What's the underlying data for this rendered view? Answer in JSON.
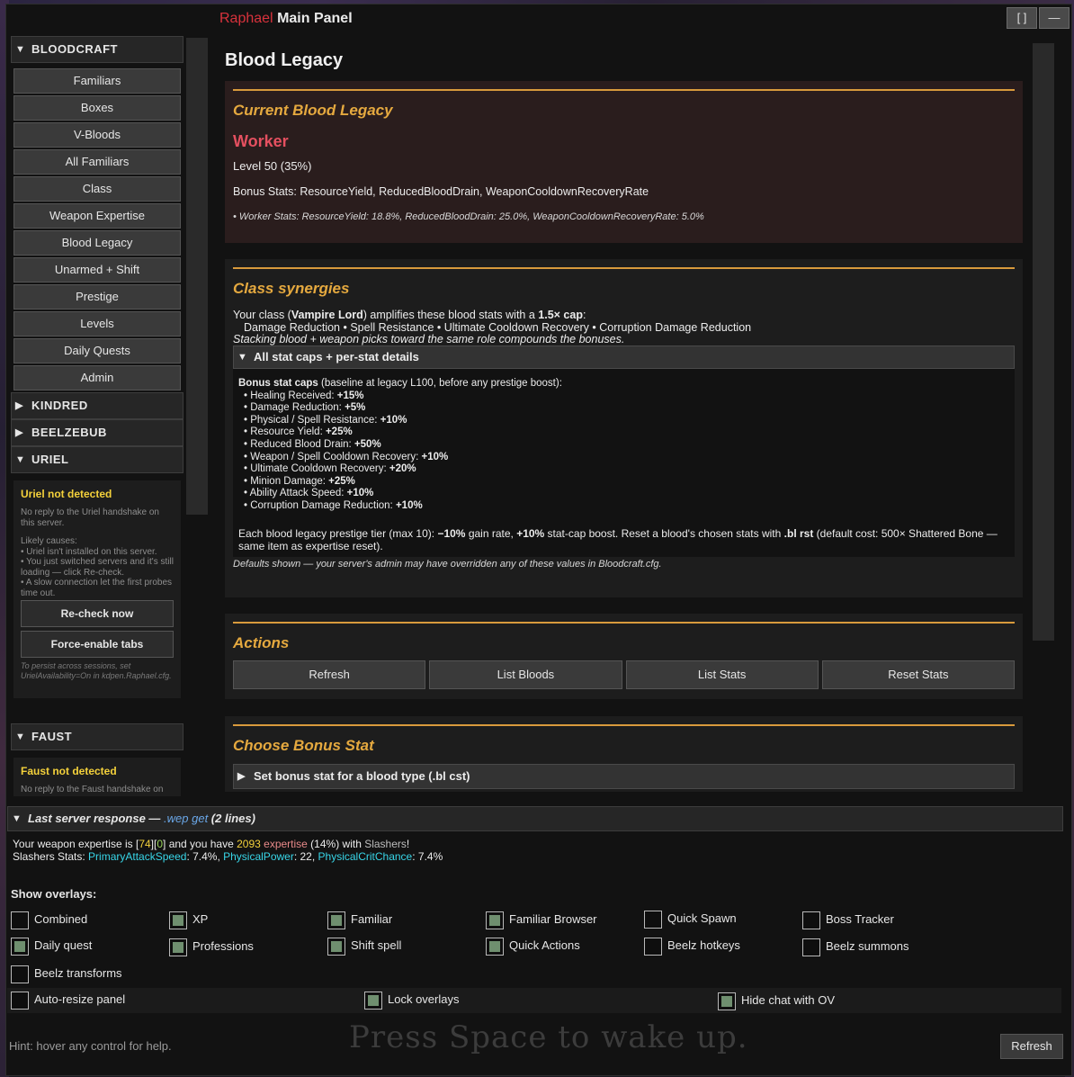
{
  "window": {
    "brand": "Raphael",
    "title": "Main Panel",
    "btn_restore": "[ ]",
    "btn_minimize": "—"
  },
  "sidebar": {
    "bloodcraft": {
      "header": "BLOODCRAFT",
      "items": [
        "Familiars",
        "Boxes",
        "V-Bloods",
        "All Familiars",
        "Class",
        "Weapon Expertise",
        "Blood Legacy",
        "Unarmed + Shift",
        "Prestige",
        "Levels",
        "Daily Quests",
        "Admin"
      ]
    },
    "kindred": "KINDRED",
    "beelzebub": "BEELZEBUB",
    "uriel": {
      "header": "URIEL",
      "warn": "Uriel not detected",
      "desc": "No reply to the Uriel handshake on this server.",
      "causes_title": "Likely causes:",
      "cause1": "• Uriel isn't installed on this server.",
      "cause2": "• You just switched servers and it's still loading — click Re-check.",
      "cause3": "• A slow connection let the first probes time out.",
      "recheck": "Re-check now",
      "force": "Force-enable tabs",
      "persist_note": "To persist across sessions, set UrielAvailability=On in kdpen.Raphael.cfg."
    },
    "faust": {
      "header": "FAUST",
      "warn": "Faust not detected",
      "desc": "No reply to the Faust handshake on"
    }
  },
  "main": {
    "page_title": "Blood Legacy",
    "current": {
      "heading": "Current Blood Legacy",
      "name": "Worker",
      "level": "Level 50  (35%)",
      "bonus": "Bonus Stats: ResourceYield, ReducedBloodDrain, WeaponCooldownRecoveryRate",
      "stats": "• Worker Stats: ResourceYield: 18.8%, ReducedBloodDrain: 25.0%, WeaponCooldownRecoveryRate: 5.0%"
    },
    "synergies": {
      "heading": "Class synergies",
      "intro_a": "Your class (",
      "class_name": "Vampire Lord",
      "intro_b": ") amplifies these blood stats with a ",
      "cap": "1.5× cap",
      "intro_c": ":",
      "stats_line": "Damage Reduction  •  Spell Resistance  •  Ultimate Cooldown Recovery  •  Corruption Damage Reduction",
      "stacking": "Stacking blood + weapon picks toward the same role compounds the bonuses.",
      "details_header": "All stat caps + per-stat details",
      "caps_title": "Bonus stat caps",
      "caps_note": " (baseline at legacy L100, before any prestige boost):",
      "caps": [
        {
          "label": "• Healing Received: ",
          "value": "+15%"
        },
        {
          "label": "• Damage Reduction: ",
          "value": "+5%"
        },
        {
          "label": "• Physical / Spell Resistance: ",
          "value": "+10%"
        },
        {
          "label": "• Resource Yield: ",
          "value": "+25%"
        },
        {
          "label": "• Reduced Blood Drain: ",
          "value": "+50%"
        },
        {
          "label": "• Weapon / Spell Cooldown Recovery: ",
          "value": "+10%"
        },
        {
          "label": "• Ultimate Cooldown Recovery: ",
          "value": "+20%"
        },
        {
          "label": "• Minion Damage: ",
          "value": "+25%"
        },
        {
          "label": "• Ability Attack Speed: ",
          "value": "+10%"
        },
        {
          "label": "• Corruption Damage Reduction: ",
          "value": "+10%"
        }
      ],
      "prestige_a": "Each blood legacy prestige tier (max 10): ",
      "prestige_b": "−10%",
      "prestige_c": " gain rate, ",
      "prestige_d": "+10%",
      "prestige_e": " stat-cap boost. Reset a blood's chosen stats with ",
      "prestige_f": ".bl rst",
      "prestige_g": " (default cost: 500× Shattered Bone — same item as expertise reset).",
      "defaults": "Defaults shown — your server's admin may have overridden any of these values in Bloodcraft.cfg."
    },
    "actions": {
      "heading": "Actions",
      "buttons": [
        "Refresh",
        "List Bloods",
        "List Stats",
        "Reset Stats"
      ]
    },
    "choose": {
      "heading": "Choose Bonus Stat",
      "subheader": "Set bonus stat for a blood type (.bl cst)"
    }
  },
  "response": {
    "prefix": "Last server response — ",
    "command": ".wep get",
    "count": "  (2 lines)",
    "l1_a": "Your weapon expertise is [",
    "l1_lvl": "74",
    "l1_b": "][",
    "l1_pr": "0",
    "l1_c": "] and you have ",
    "l1_xp": "2093",
    "l1_d": " ",
    "l1_exp": "expertise",
    "l1_e": " (14%) with ",
    "l1_weapon": "Slashers",
    "l1_f": "!",
    "l2_a": "Slashers Stats: ",
    "l2_s1": "PrimaryAttackSpeed",
    "l2_v1": ": 7.4%, ",
    "l2_s2": "PhysicalPower",
    "l2_v2": ": 22, ",
    "l2_s3": "PhysicalCritChance",
    "l2_v3": ": 7.4%"
  },
  "overlays": {
    "label": "Show overlays:",
    "items": [
      {
        "label": "Combined",
        "checked": false
      },
      {
        "label": "XP",
        "checked": true
      },
      {
        "label": "Familiar",
        "checked": true
      },
      {
        "label": "Familiar Browser",
        "checked": true
      },
      {
        "label": "Quick Spawn",
        "checked": false
      },
      {
        "label": "Boss Tracker",
        "checked": false
      },
      {
        "label": "Daily quest",
        "checked": true
      },
      {
        "label": "Professions",
        "checked": true
      },
      {
        "label": "Shift spell",
        "checked": true
      },
      {
        "label": "Quick Actions",
        "checked": true
      },
      {
        "label": "Beelz hotkeys",
        "checked": false
      },
      {
        "label": "Beelz summons",
        "checked": false
      },
      {
        "label": "Beelz transforms",
        "checked": false
      }
    ],
    "options": [
      {
        "label": "Auto-resize panel",
        "checked": false
      },
      {
        "label": "Lock overlays",
        "checked": true
      },
      {
        "label": "Hide chat with OV",
        "checked": true
      }
    ]
  },
  "footer": {
    "hint": "Hint: hover any control for help.",
    "wake": "Press Space to wake up.",
    "refresh": "Refresh"
  },
  "colors": {
    "accent_gold": "#e5a93f",
    "brand_red": "#d8323c",
    "warn_yellow": "#f4d13b",
    "legacy_red": "#e55060",
    "stat_cyan": "#38d6e8"
  }
}
